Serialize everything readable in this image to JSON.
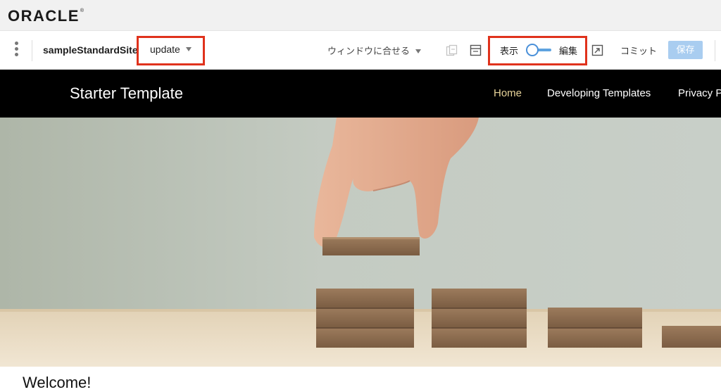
{
  "brand": {
    "logo_text": "ORACLE",
    "logo_mark": "®"
  },
  "toolbar": {
    "site_name": "sampleStandardSite",
    "update_select": "update",
    "fit_select": "ウィンドウに合せる",
    "view_label": "表示",
    "edit_label": "編集",
    "commit_label": "コミット",
    "save_label": "保存"
  },
  "site": {
    "title": "Starter Template",
    "nav": [
      "Home",
      "Developing Templates",
      "Privacy P"
    ]
  },
  "main": {
    "heading": "Welcome!"
  },
  "colors": {
    "highlight": "#e0321c",
    "active_nav": "#e8d49a",
    "toggle": "#4a90d9",
    "save_button": "#a9cdf0"
  },
  "icons": [
    "kebab-menu-icon",
    "page-properties-icon",
    "layout-icon",
    "open-preview-icon"
  ]
}
